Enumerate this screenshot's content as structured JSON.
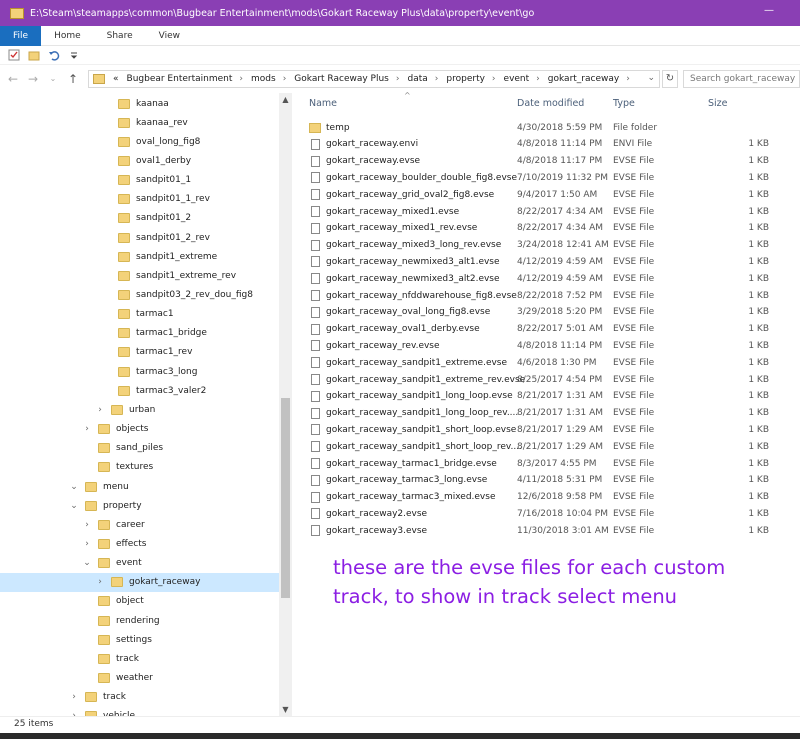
{
  "window": {
    "title": "E:\\Steam\\steamapps\\common\\Bugbear Entertainment\\mods\\Gokart Raceway Plus\\data\\property\\event\\go",
    "accent": "#8a3fb4"
  },
  "ribbon": {
    "tabs": [
      "File",
      "Home",
      "Share",
      "View"
    ]
  },
  "address": {
    "prefix": "«",
    "crumbs": [
      "Bugbear Entertainment",
      "mods",
      "Gokart Raceway Plus",
      "data",
      "property",
      "event",
      "gokart_raceway"
    ],
    "search_placeholder": "Search gokart_raceway"
  },
  "tree": [
    {
      "label": "kaanaa",
      "indent": 3,
      "exp": ""
    },
    {
      "label": "kaanaa_rev",
      "indent": 3,
      "exp": ""
    },
    {
      "label": "oval_long_fig8",
      "indent": 3,
      "exp": ""
    },
    {
      "label": "oval1_derby",
      "indent": 3,
      "exp": ""
    },
    {
      "label": "sandpit01_1",
      "indent": 3,
      "exp": ""
    },
    {
      "label": "sandpit01_1_rev",
      "indent": 3,
      "exp": ""
    },
    {
      "label": "sandpit01_2",
      "indent": 3,
      "exp": ""
    },
    {
      "label": "sandpit01_2_rev",
      "indent": 3,
      "exp": ""
    },
    {
      "label": "sandpit1_extreme",
      "indent": 3,
      "exp": ""
    },
    {
      "label": "sandpit1_extreme_rev",
      "indent": 3,
      "exp": ""
    },
    {
      "label": "sandpit03_2_rev_dou_fig8",
      "indent": 3,
      "exp": ""
    },
    {
      "label": "tarmac1",
      "indent": 3,
      "exp": ""
    },
    {
      "label": "tarmac1_bridge",
      "indent": 3,
      "exp": ""
    },
    {
      "label": "tarmac1_rev",
      "indent": 3,
      "exp": ""
    },
    {
      "label": "tarmac3_long",
      "indent": 3,
      "exp": ""
    },
    {
      "label": "tarmac3_valer2",
      "indent": 3,
      "exp": ""
    },
    {
      "label": "urban",
      "indent": 2,
      "exp": "›"
    },
    {
      "label": "objects",
      "indent": 1,
      "exp": "›"
    },
    {
      "label": "sand_piles",
      "indent": 1,
      "exp": ""
    },
    {
      "label": "textures",
      "indent": 1,
      "exp": ""
    },
    {
      "label": "menu",
      "indent": 0,
      "exp": "⌄"
    },
    {
      "label": "property",
      "indent": 0,
      "exp": "⌄"
    },
    {
      "label": "career",
      "indent": 1,
      "exp": "›"
    },
    {
      "label": "effects",
      "indent": 1,
      "exp": "›"
    },
    {
      "label": "event",
      "indent": 1,
      "exp": "⌄"
    },
    {
      "label": "gokart_raceway",
      "indent": 2,
      "exp": "›",
      "selected": true
    },
    {
      "label": "object",
      "indent": 1,
      "exp": ""
    },
    {
      "label": "rendering",
      "indent": 1,
      "exp": ""
    },
    {
      "label": "settings",
      "indent": 1,
      "exp": ""
    },
    {
      "label": "track",
      "indent": 1,
      "exp": ""
    },
    {
      "label": "weather",
      "indent": 1,
      "exp": ""
    },
    {
      "label": "track",
      "indent": 0,
      "exp": "›"
    },
    {
      "label": "vehicle",
      "indent": 0,
      "exp": "›"
    }
  ],
  "columns": {
    "name": "Name",
    "date": "Date modified",
    "type": "Type",
    "size": "Size"
  },
  "files": [
    {
      "name": "temp",
      "date": "4/30/2018 5:59 PM",
      "type": "File folder",
      "size": "",
      "folder": true
    },
    {
      "name": "gokart_raceway.envi",
      "date": "4/8/2018 11:14 PM",
      "type": "ENVI File",
      "size": "1 KB"
    },
    {
      "name": "gokart_raceway.evse",
      "date": "4/8/2018 11:17 PM",
      "type": "EVSE File",
      "size": "1 KB"
    },
    {
      "name": "gokart_raceway_boulder_double_fig8.evse",
      "date": "7/10/2019 11:32 PM",
      "type": "EVSE File",
      "size": "1 KB"
    },
    {
      "name": "gokart_raceway_grid_oval2_fig8.evse",
      "date": "9/4/2017 1:50 AM",
      "type": "EVSE File",
      "size": "1 KB"
    },
    {
      "name": "gokart_raceway_mixed1.evse",
      "date": "8/22/2017 4:34 AM",
      "type": "EVSE File",
      "size": "1 KB"
    },
    {
      "name": "gokart_raceway_mixed1_rev.evse",
      "date": "8/22/2017 4:34 AM",
      "type": "EVSE File",
      "size": "1 KB"
    },
    {
      "name": "gokart_raceway_mixed3_long_rev.evse",
      "date": "3/24/2018 12:41 AM",
      "type": "EVSE File",
      "size": "1 KB"
    },
    {
      "name": "gokart_raceway_newmixed3_alt1.evse",
      "date": "4/12/2019 4:59 AM",
      "type": "EVSE File",
      "size": "1 KB"
    },
    {
      "name": "gokart_raceway_newmixed3_alt2.evse",
      "date": "4/12/2019 4:59 AM",
      "type": "EVSE File",
      "size": "1 KB"
    },
    {
      "name": "gokart_raceway_nfddwarehouse_fig8.evse",
      "date": "8/22/2018 7:52 PM",
      "type": "EVSE File",
      "size": "1 KB"
    },
    {
      "name": "gokart_raceway_oval_long_fig8.evse",
      "date": "3/29/2018 5:20 PM",
      "type": "EVSE File",
      "size": "1 KB"
    },
    {
      "name": "gokart_raceway_oval1_derby.evse",
      "date": "8/22/2017 5:01 AM",
      "type": "EVSE File",
      "size": "1 KB"
    },
    {
      "name": "gokart_raceway_rev.evse",
      "date": "4/8/2018 11:14 PM",
      "type": "EVSE File",
      "size": "1 KB"
    },
    {
      "name": "gokart_raceway_sandpit1_extreme.evse",
      "date": "4/6/2018 1:30 PM",
      "type": "EVSE File",
      "size": "1 KB"
    },
    {
      "name": "gokart_raceway_sandpit1_extreme_rev.evse",
      "date": "8/25/2017 4:54 PM",
      "type": "EVSE File",
      "size": "1 KB"
    },
    {
      "name": "gokart_raceway_sandpit1_long_loop.evse",
      "date": "8/21/2017 1:31 AM",
      "type": "EVSE File",
      "size": "1 KB"
    },
    {
      "name": "gokart_raceway_sandpit1_long_loop_rev....",
      "date": "8/21/2017 1:31 AM",
      "type": "EVSE File",
      "size": "1 KB"
    },
    {
      "name": "gokart_raceway_sandpit1_short_loop.evse",
      "date": "8/21/2017 1:29 AM",
      "type": "EVSE File",
      "size": "1 KB"
    },
    {
      "name": "gokart_raceway_sandpit1_short_loop_rev....",
      "date": "8/21/2017 1:29 AM",
      "type": "EVSE File",
      "size": "1 KB"
    },
    {
      "name": "gokart_raceway_tarmac1_bridge.evse",
      "date": "8/3/2017 4:55 PM",
      "type": "EVSE File",
      "size": "1 KB"
    },
    {
      "name": "gokart_raceway_tarmac3_long.evse",
      "date": "4/11/2018 5:31 PM",
      "type": "EVSE File",
      "size": "1 KB"
    },
    {
      "name": "gokart_raceway_tarmac3_mixed.evse",
      "date": "12/6/2018 9:58 PM",
      "type": "EVSE File",
      "size": "1 KB"
    },
    {
      "name": "gokart_raceway2.evse",
      "date": "7/16/2018 10:04 PM",
      "type": "EVSE File",
      "size": "1 KB"
    },
    {
      "name": "gokart_raceway3.evse",
      "date": "11/30/2018 3:01 AM",
      "type": "EVSE File",
      "size": "1 KB"
    }
  ],
  "annotation": {
    "text": "these are the evse files for each custom track, to show in track select menu",
    "color": "#8b1ee3"
  },
  "status": {
    "items": "25 items"
  }
}
